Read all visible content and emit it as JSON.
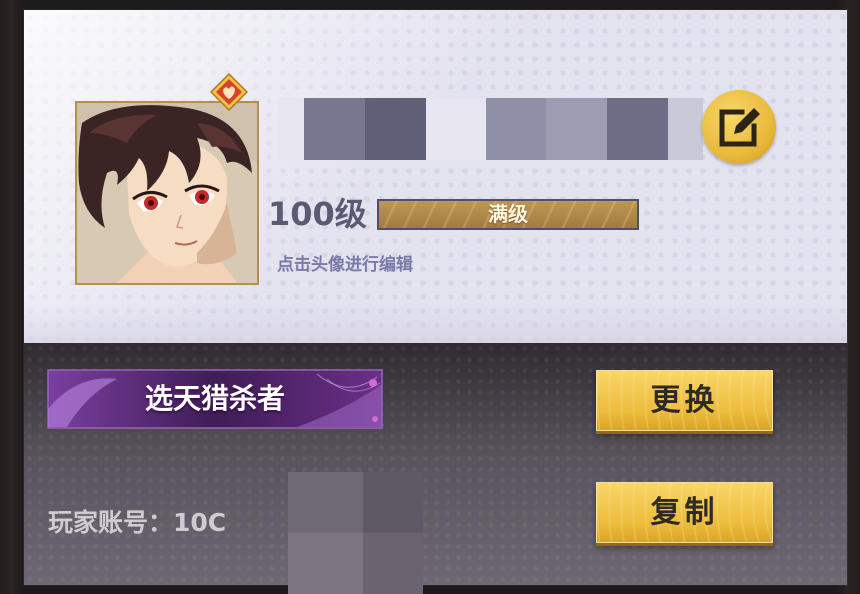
{
  "profile": {
    "name_hidden": true,
    "level_label": "100级",
    "level_progress": 1.0,
    "level_bar_label": "满级",
    "avatar_hint": "点击头像进行编辑"
  },
  "title": {
    "label": "选天猎杀者"
  },
  "actions": {
    "change_label": "更换",
    "copy_label": "复制"
  },
  "account": {
    "label": "玩家账号：",
    "value_visible": "10C"
  },
  "icons": {
    "edit": "edit-pencil-icon",
    "badge": "avatar-frame-badge-icon"
  },
  "colors": {
    "panel_top_bg": "#e3e2ef",
    "gold_button": "#ecbb3a",
    "title_banner": "#5a2f6e",
    "level_text": "#5b5a73",
    "hint_text": "#7a7aa8"
  }
}
